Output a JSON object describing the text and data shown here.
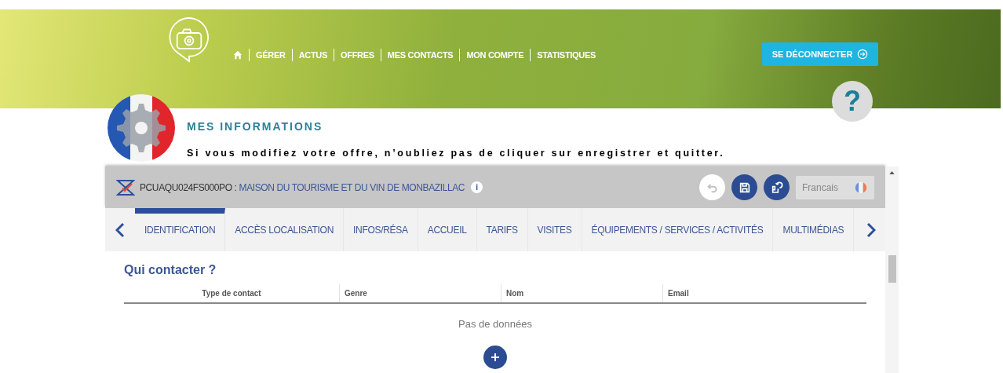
{
  "header": {
    "nav": [
      {
        "kind": "home"
      },
      {
        "kind": "link",
        "label": "GÉRER"
      },
      {
        "kind": "link",
        "label": "ACTUS"
      },
      {
        "kind": "link",
        "label": "OFFRES"
      },
      {
        "kind": "link",
        "label": "MES CONTACTS"
      },
      {
        "kind": "link",
        "label": "MON COMPTE"
      },
      {
        "kind": "link",
        "label": "STATISTIQUES"
      }
    ],
    "logout": "SE DÉCONNECTER",
    "help": "?"
  },
  "section": {
    "title": "MES INFORMATIONS",
    "notice": "Si vous modifiez votre offre, n’oubliez pas de cliquer sur enregistrer et quitter."
  },
  "offer": {
    "code": "PCUAQU024FS000PO :",
    "name": "MAISON DU TOURISME ET DU VIN DE MONBAZILLAC",
    "info": "i",
    "language": "Francais",
    "actions": [
      {
        "kind": "undo",
        "disabled": true
      },
      {
        "kind": "save",
        "disabled": false
      },
      {
        "kind": "save_exit",
        "disabled": false
      }
    ]
  },
  "tabs": [
    {
      "label": "IDENTIFICATION",
      "selected": true
    },
    {
      "label": "ACCÈS LOCALISATION",
      "selected": false
    },
    {
      "label": "INFOS/RÉSA",
      "selected": false
    },
    {
      "label": "ACCUEIL",
      "selected": false
    },
    {
      "label": "TARIFS",
      "selected": false
    },
    {
      "label": "VISITES",
      "selected": false
    },
    {
      "label": "ÉQUIPEMENTS / SERVICES / ACTIVITÉS",
      "selected": false
    },
    {
      "label": "MULTIMÉDIAS",
      "selected": false
    }
  ],
  "contacts": {
    "title": "Qui contacter ?",
    "columns": [
      "Type de contact",
      "Genre",
      "Nom",
      "Email"
    ],
    "empty": "Pas de données"
  }
}
